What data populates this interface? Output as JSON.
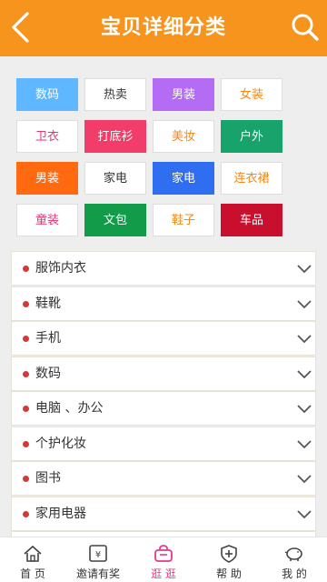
{
  "header": {
    "title": "宝贝详细分类"
  },
  "categories": [
    {
      "label": "数码",
      "bg": "#5eb7ff",
      "fg": "#ffffff"
    },
    {
      "label": "热卖",
      "bg": "#ffffff",
      "fg": "#333333"
    },
    {
      "label": "男装",
      "bg": "#b46cf5",
      "fg": "#ffffff"
    },
    {
      "label": "女装",
      "bg": "#ffffff",
      "fg": "#f28a1e"
    },
    {
      "label": "卫衣",
      "bg": "#ffffff",
      "fg": "#e0357a"
    },
    {
      "label": "打底衫",
      "bg": "#f23d6a",
      "fg": "#ffffff"
    },
    {
      "label": "美妆",
      "bg": "#ffffff",
      "fg": "#f28a1e"
    },
    {
      "label": "户外",
      "bg": "#17a36b",
      "fg": "#ffffff"
    },
    {
      "label": "男装",
      "bg": "#ff6a10",
      "fg": "#ffffff"
    },
    {
      "label": "家电",
      "bg": "#ffffff",
      "fg": "#333333"
    },
    {
      "label": "家电",
      "bg": "#2f6ef0",
      "fg": "#ffffff"
    },
    {
      "label": "连衣裙",
      "bg": "#ffffff",
      "fg": "#f28a1e"
    },
    {
      "label": "童装",
      "bg": "#ffffff",
      "fg": "#e0357a"
    },
    {
      "label": "文包",
      "bg": "#129c4a",
      "fg": "#ffffff"
    },
    {
      "label": "鞋子",
      "bg": "#ffffff",
      "fg": "#f28a1e"
    },
    {
      "label": "车品",
      "bg": "#c8102e",
      "fg": "#ffffff"
    }
  ],
  "list": [
    {
      "label": "服饰内衣"
    },
    {
      "label": "鞋靴"
    },
    {
      "label": "手机"
    },
    {
      "label": "数码"
    },
    {
      "label": "电脑 、办公"
    },
    {
      "label": "个护化妆"
    },
    {
      "label": "图书"
    },
    {
      "label": "家用电器"
    },
    {
      "label": ""
    }
  ],
  "tabs": [
    {
      "label": "首 页",
      "icon": "home-icon",
      "active": false
    },
    {
      "label": "邀请有奖",
      "icon": "invite-ticket-icon",
      "active": false
    },
    {
      "label": "逛 逛",
      "icon": "shopping-bag-icon",
      "active": true
    },
    {
      "label": "帮 助",
      "icon": "help-shield-icon",
      "active": false
    },
    {
      "label": "我 的",
      "icon": "piggy-bank-icon",
      "active": false
    }
  ],
  "colors": {
    "accent": "#f7941d",
    "active_tab": "#e8388a",
    "bullet": "#d23a3a"
  }
}
